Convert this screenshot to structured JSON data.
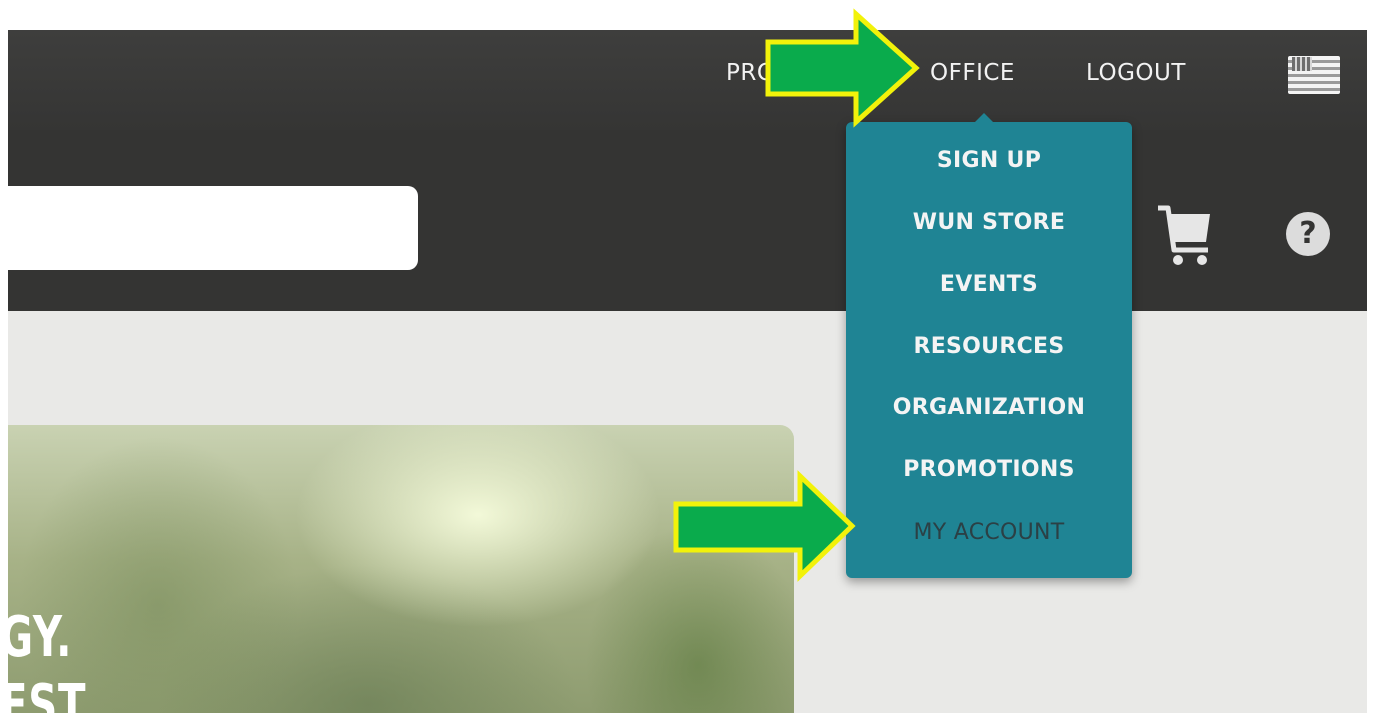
{
  "topbar": {
    "products_label": "PRODUCTS",
    "office_label": "OFFICE",
    "logout_label": "LOGOUT",
    "language_icon": "us-flag-icon"
  },
  "header": {
    "search_value": "",
    "cart_icon": "shopping-cart-icon",
    "help_label": "?"
  },
  "dropdown": {
    "items": [
      {
        "label": "SIGN UP"
      },
      {
        "label": "WUN STORE"
      },
      {
        "label": "EVENTS"
      },
      {
        "label": "RESOURCES"
      },
      {
        "label": "ORGANIZATION"
      },
      {
        "label": "PROMOTIONS"
      },
      {
        "label": "MY ACCOUNT"
      }
    ],
    "background_color": "#1f8494"
  },
  "hero": {
    "line1": "GY.",
    "line2": "EST"
  },
  "annotations": {
    "arrow_color": "#0aab4c",
    "arrow_outline": "#f2f20a"
  }
}
